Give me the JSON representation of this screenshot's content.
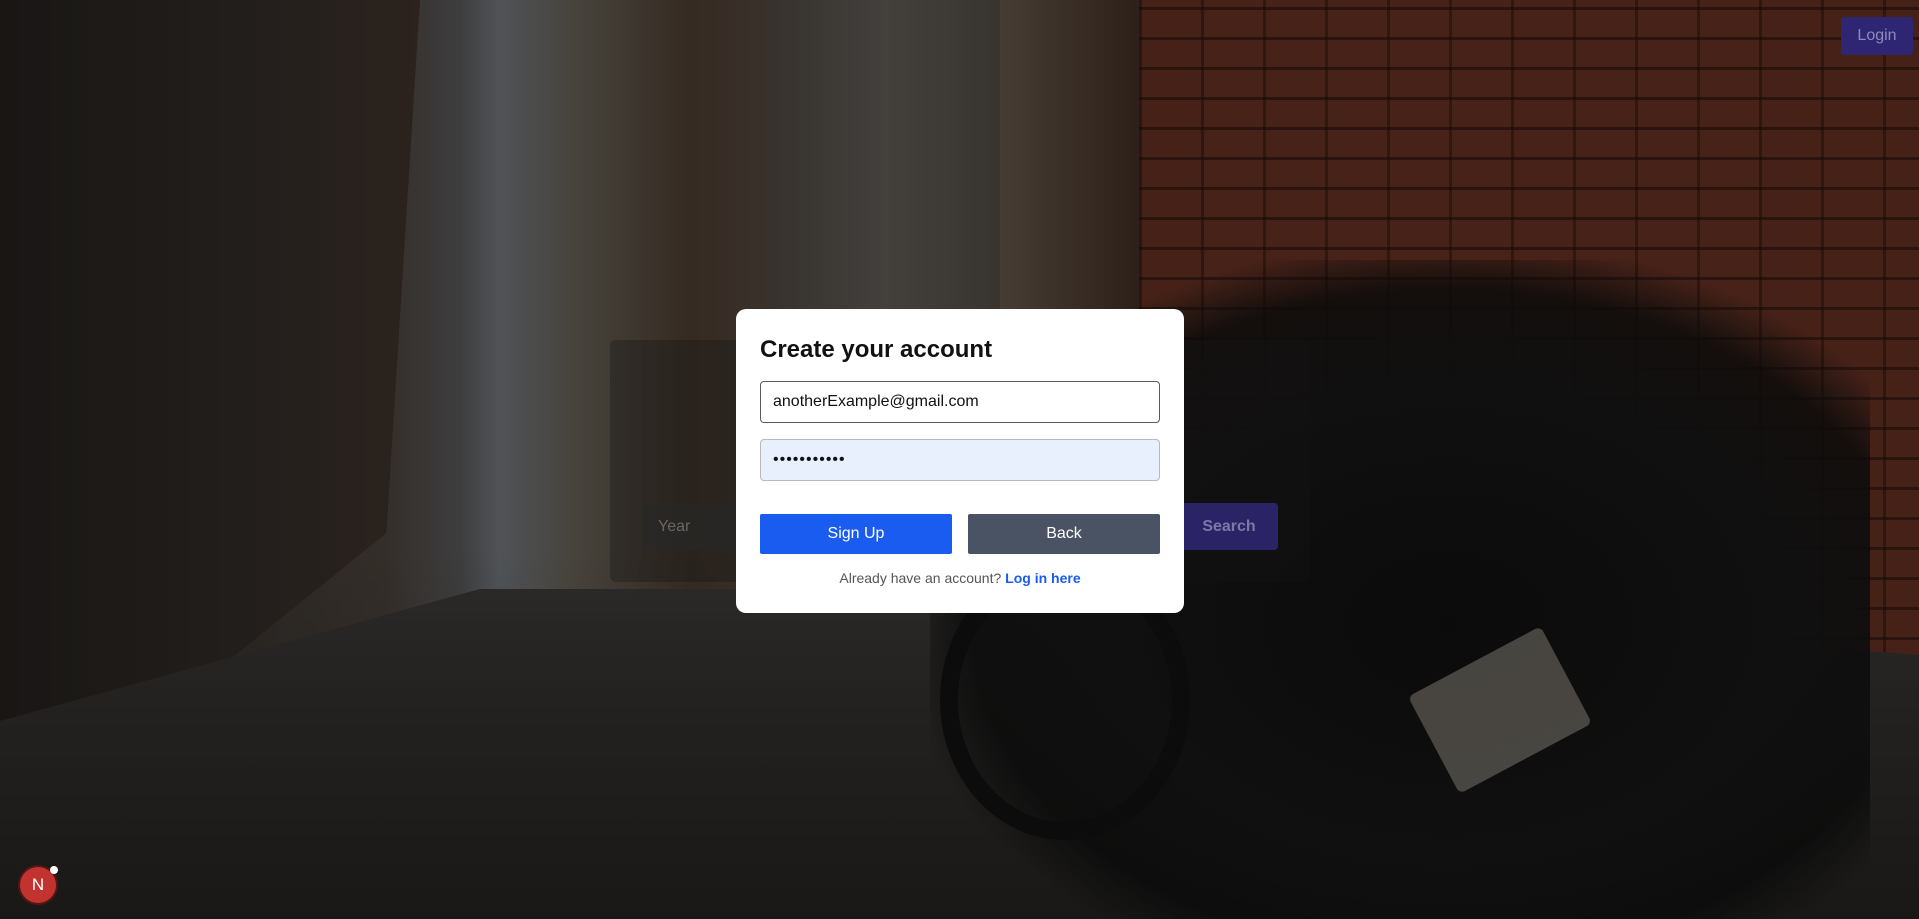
{
  "header": {
    "login_label": "Login"
  },
  "search_panel": {
    "year_placeholder": "Year",
    "search_label": "Search"
  },
  "modal": {
    "title": "Create your account",
    "email_value": "anotherExample@gmail.com",
    "password_value": "•••••••••••",
    "signup_label": "Sign Up",
    "back_label": "Back",
    "footer_prefix": "Already have an account?",
    "footer_link": "Log in here"
  },
  "badge": {
    "letter": "N"
  },
  "colors": {
    "primary": "#1a5cf0",
    "secondary": "#4a5363",
    "login_bg": "#2e2573",
    "badge": "#c2332f"
  }
}
